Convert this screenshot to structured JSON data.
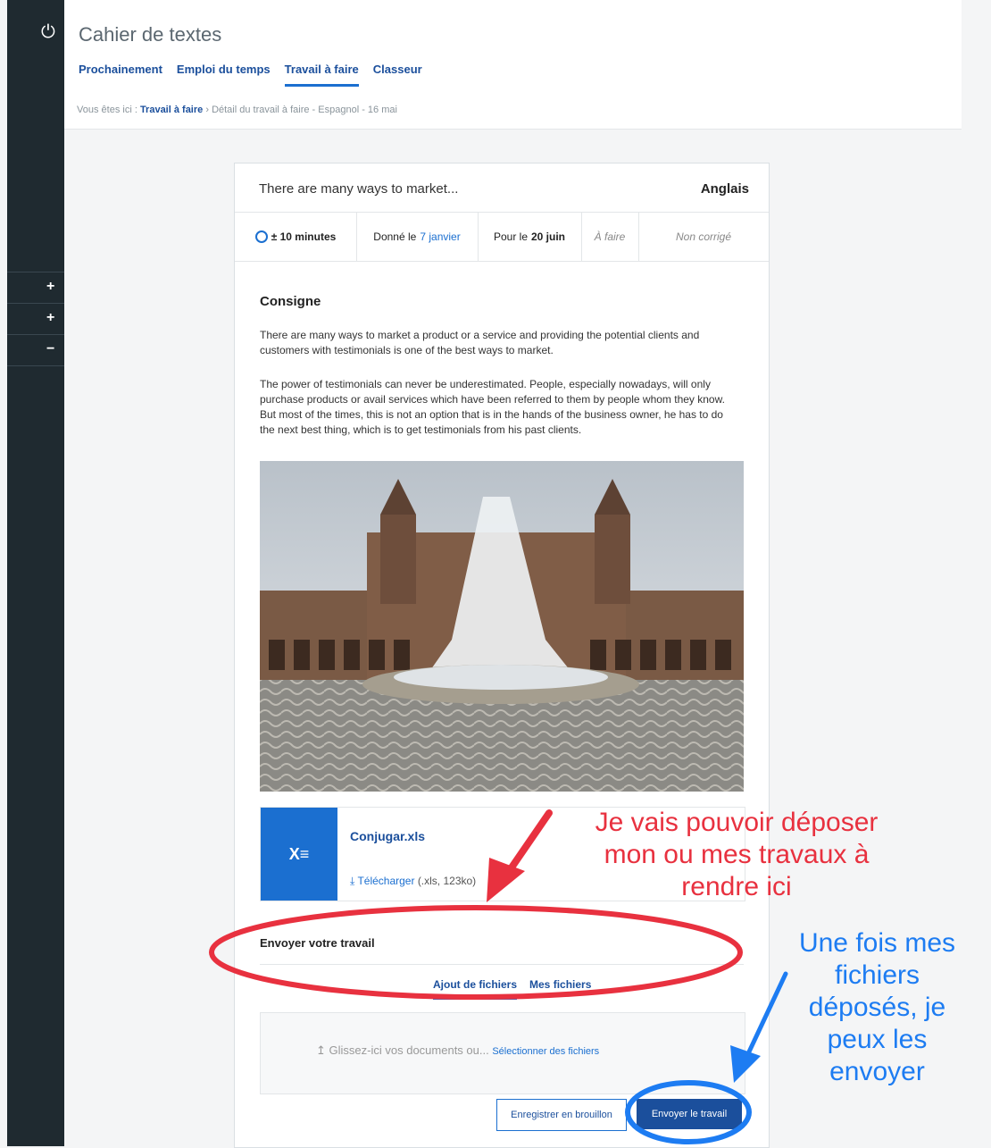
{
  "app": {
    "title": "Cahier de textes",
    "tabs": [
      "Prochainement",
      "Emploi du temps",
      "Travail à faire",
      "Classeur"
    ],
    "active_tab": "Travail à faire"
  },
  "sidebar": {
    "items": [
      "+",
      "+",
      "−"
    ]
  },
  "breadcrumb": {
    "prefix": "Vous êtes ici :",
    "link": "Travail à faire",
    "separator": "›",
    "current": "Détail du travail à faire - Espagnol - 16 mai"
  },
  "assignment": {
    "title": "There are many ways to market...",
    "subject": "Anglais",
    "duration": "± 10 minutes",
    "given_label": "Donné le",
    "given_date": "7 janvier",
    "due_label": "Pour le",
    "due_date": "20 juin",
    "status": "À faire",
    "correction": "Non corrigé",
    "instruction_heading": "Consigne",
    "paragraph_1": "There are many ways to market a product or a service and providing the potential clients and customers with testimonials is one of the best ways to market.",
    "paragraph_2": "The power of testimonials can never be underestimated. People, especially nowadays, will only purchase products or avail services which have been referred to them by people whom they know. But most of the times, this is not an option that is in the hands of the business owner, he has to do the next best thing, which is to get testimonials from his past clients."
  },
  "attachment": {
    "name": "Conjugar.xls",
    "download_label": "Télécharger",
    "download_meta": "(.xls, 123ko)"
  },
  "submission": {
    "title": "Envoyer votre travail",
    "tabs": [
      "Ajout de fichiers",
      "Mes fichiers"
    ],
    "active_tab": "Ajout de fichiers",
    "drop_text": "Glissez-ici vos documents ou...",
    "select_link": "Sélectionner des fichiers",
    "draft_button": "Enregistrer en brouillon",
    "submit_button": "Envoyer le travail"
  },
  "annotations": {
    "red_note": [
      "Je vais pouvoir déposer",
      "mon ou mes travaux à",
      "rendre ici"
    ],
    "blue_note": [
      "Une fois mes",
      "fichiers",
      "déposés, je",
      "peux les",
      "envoyer"
    ]
  }
}
